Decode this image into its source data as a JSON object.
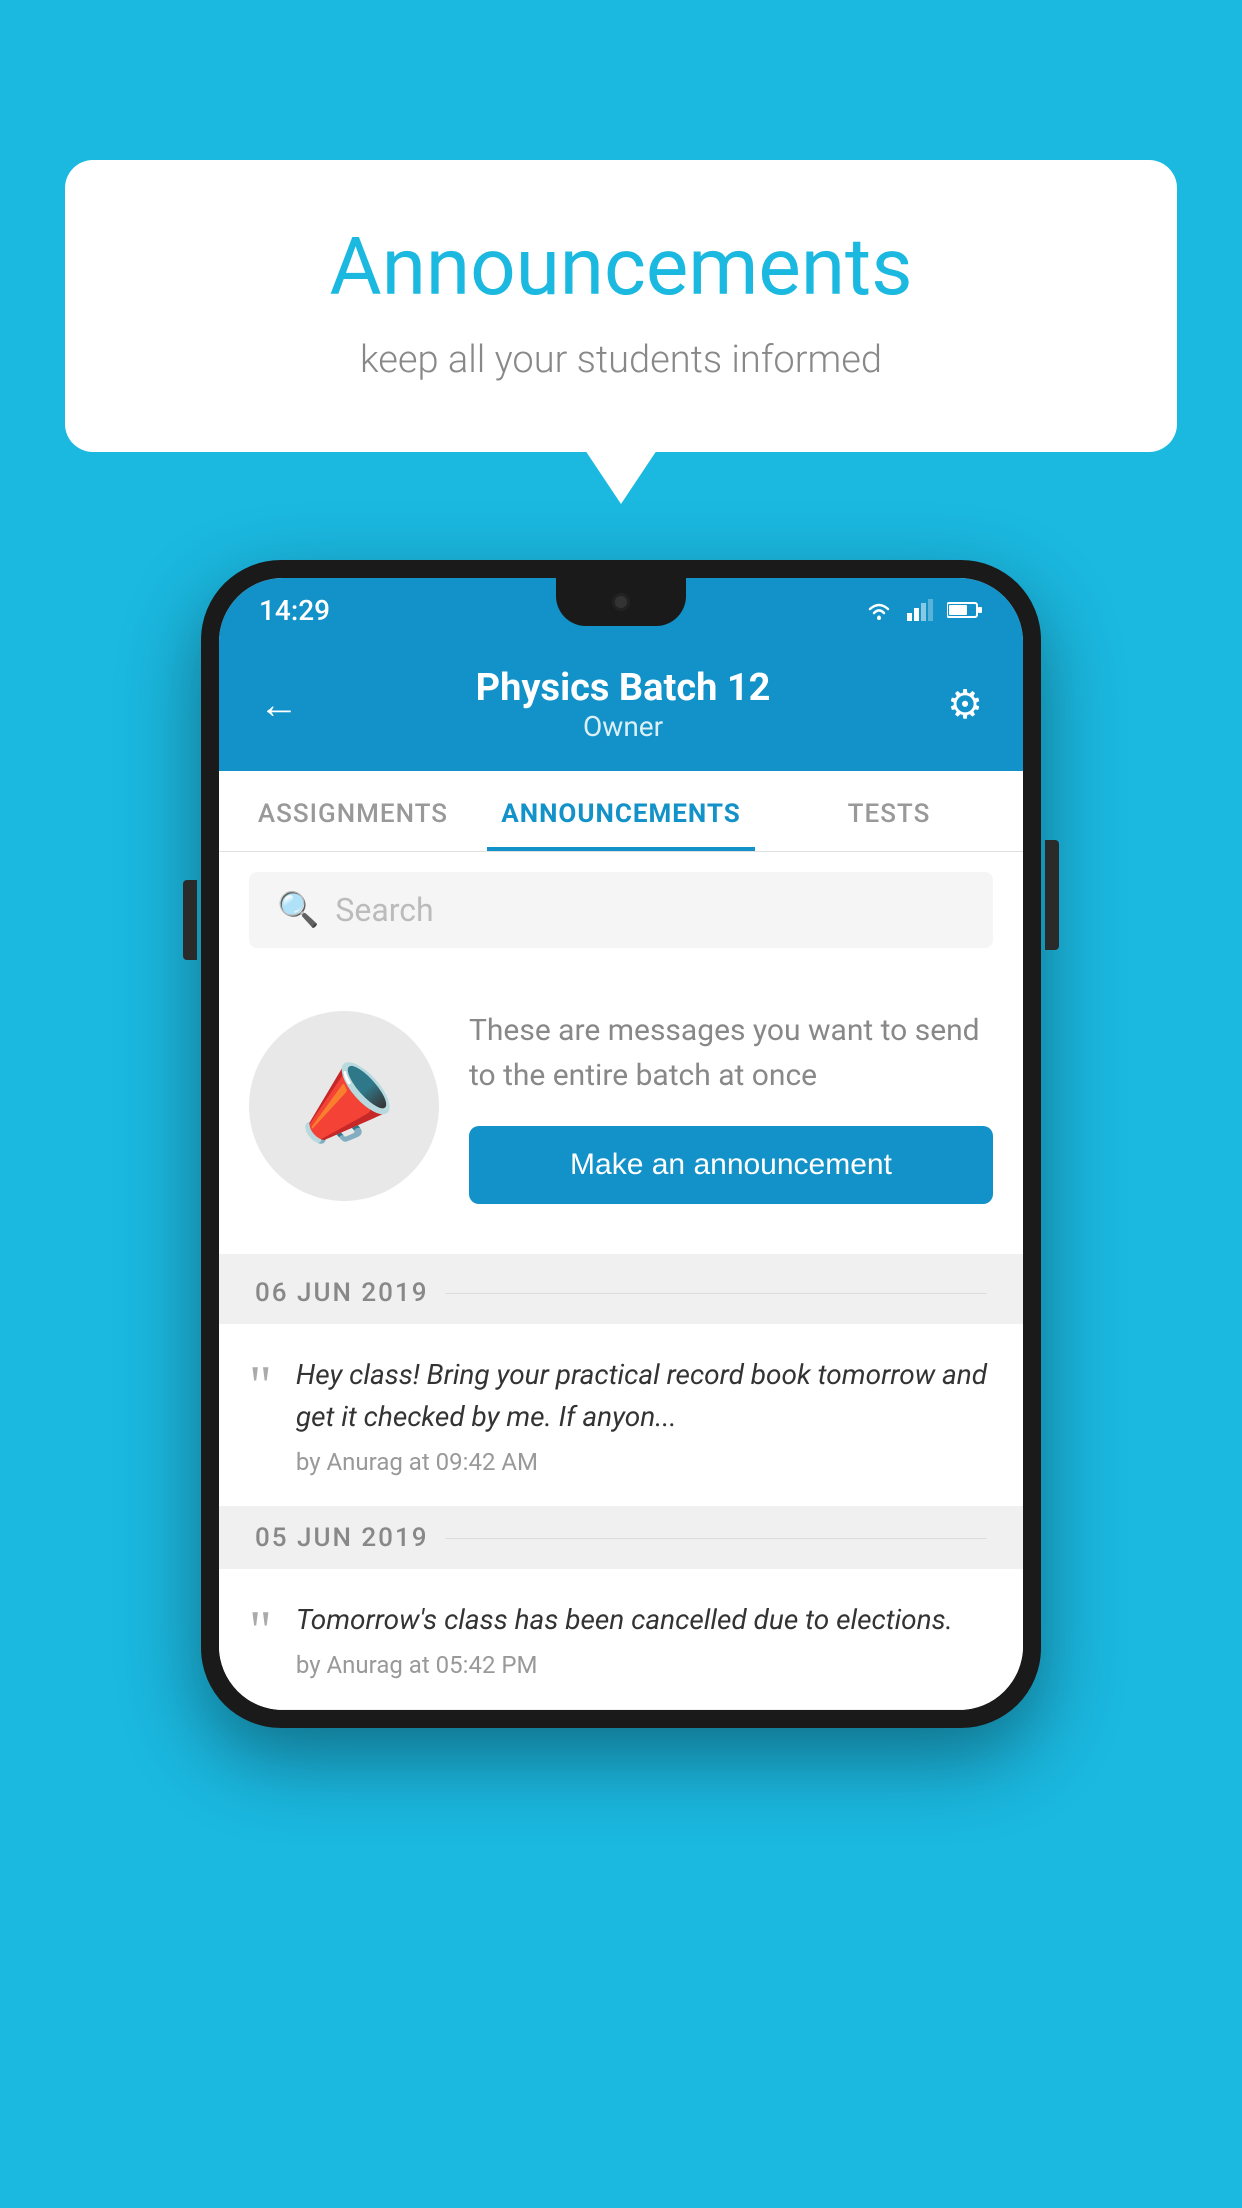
{
  "background_color": "#1BB8E0",
  "speech_bubble": {
    "title": "Announcements",
    "subtitle": "keep all your students informed"
  },
  "phone": {
    "status_bar": {
      "time": "14:29",
      "wifi": true,
      "signal": true,
      "battery": true
    },
    "header": {
      "title": "Physics Batch 12",
      "subtitle": "Owner",
      "back_label": "←",
      "gear_label": "⚙"
    },
    "tabs": [
      {
        "label": "ASSIGNMENTS",
        "active": false
      },
      {
        "label": "ANNOUNCEMENTS",
        "active": true
      },
      {
        "label": "TESTS",
        "active": false
      }
    ],
    "search": {
      "placeholder": "Search"
    },
    "promo": {
      "description": "These are messages you want to send to the entire batch at once",
      "button_label": "Make an announcement"
    },
    "announcements": [
      {
        "date": "06  JUN  2019",
        "text": "Hey class! Bring your practical record book tomorrow and get it checked by me. If anyon...",
        "meta": "by Anurag at 09:42 AM"
      },
      {
        "date": "05  JUN  2019",
        "text": "Tomorrow's class has been cancelled due to elections.",
        "meta": "by Anurag at 05:42 PM"
      }
    ]
  }
}
